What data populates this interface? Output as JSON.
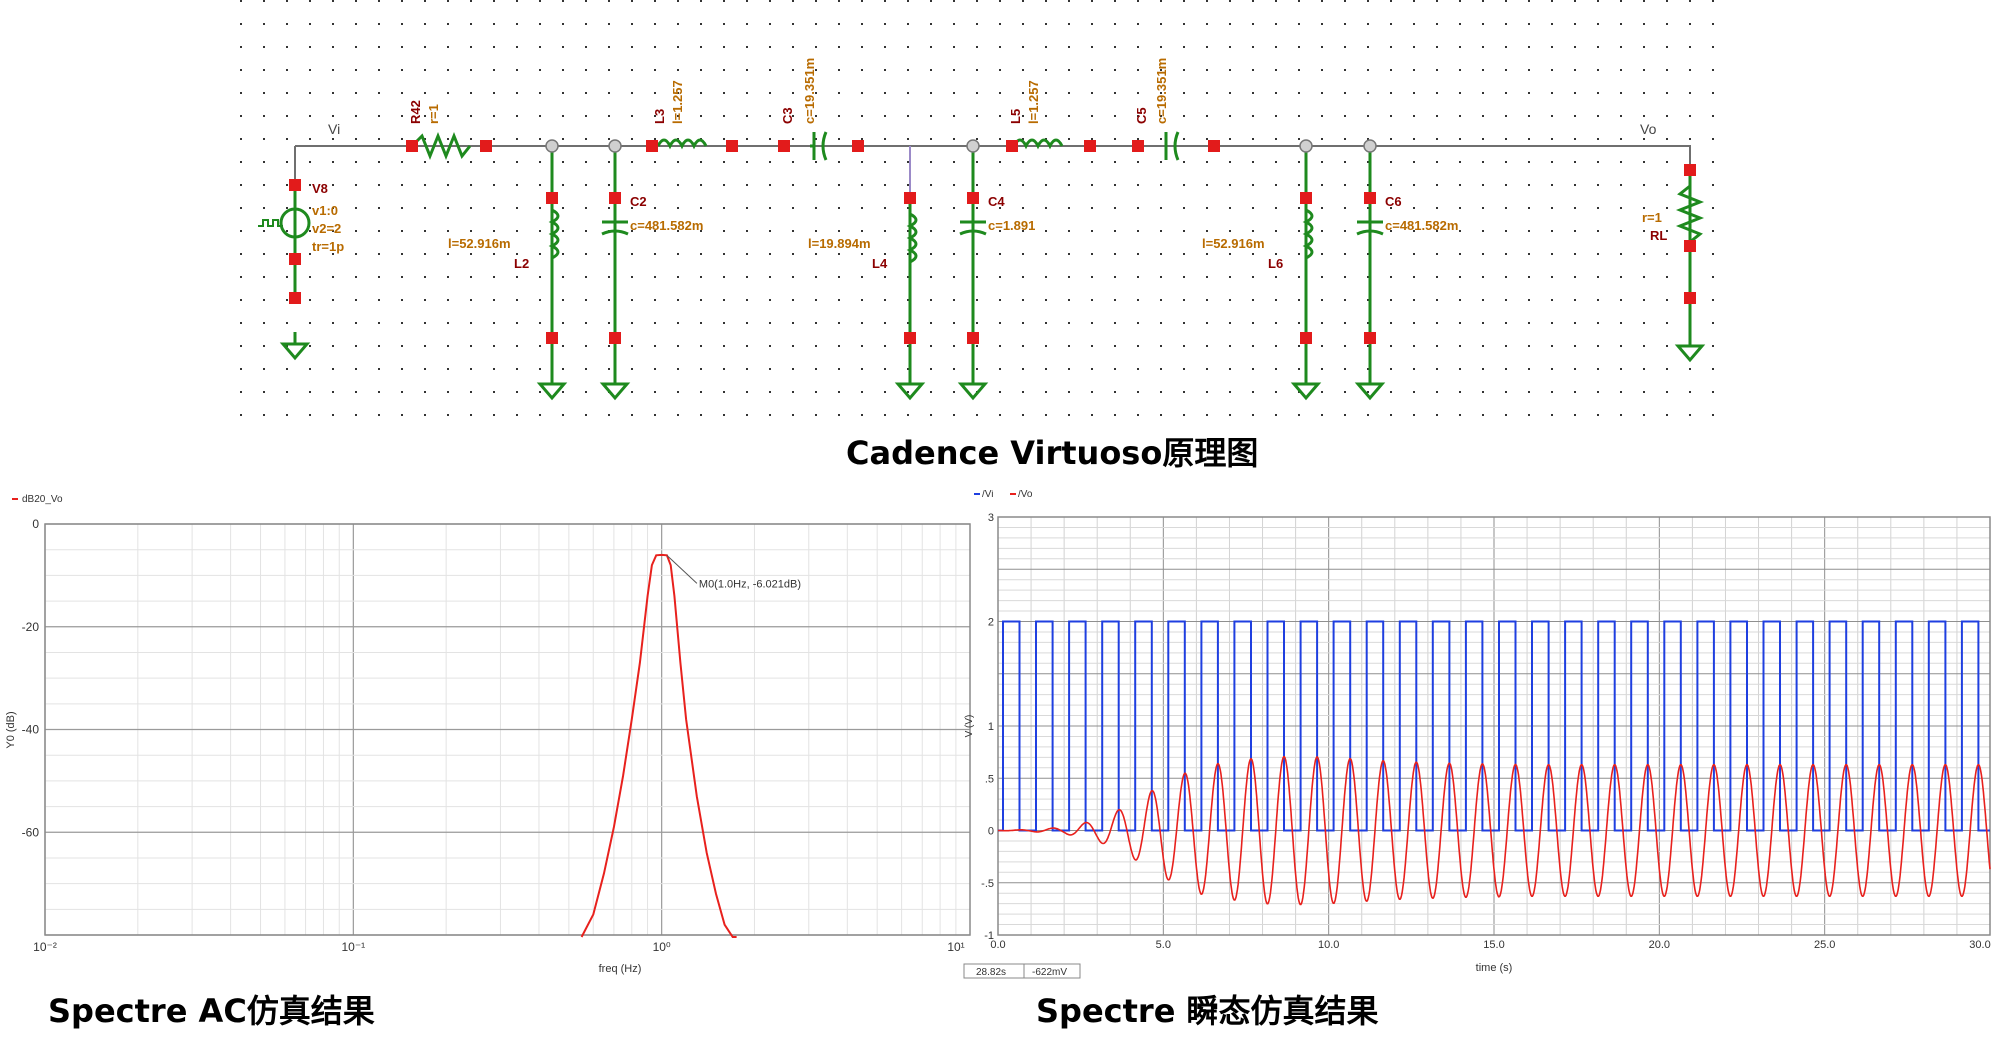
{
  "schematic": {
    "caption": "Cadence Virtuoso原理图",
    "net_labels": {
      "vi": "Vi",
      "vo": "Vo"
    },
    "source": {
      "name": "V8",
      "params": [
        "v1:0",
        "v2=2",
        "tr=1p"
      ]
    },
    "r_in": {
      "name": "R42",
      "value": "r=1"
    },
    "series_inductors": [
      {
        "name": "L3",
        "value": "l=1.257"
      },
      {
        "name": "L5",
        "value": "l=1.257"
      }
    ],
    "series_caps": [
      {
        "name": "C3",
        "value": "c=19.351m"
      },
      {
        "name": "C5",
        "value": "c=19.351m"
      }
    ],
    "shunt_inductors": [
      {
        "name": "L2",
        "value": "l=52.916m"
      },
      {
        "name": "L4",
        "value": "l=19.894m"
      },
      {
        "name": "L6",
        "value": "l=52.916m"
      }
    ],
    "shunt_caps": [
      {
        "name": "C2",
        "value": "c=481.582m"
      },
      {
        "name": "C4",
        "value": "c=1.891"
      },
      {
        "name": "C6",
        "value": "c=481.582m"
      }
    ],
    "load": {
      "name": "RL",
      "value": "r=1"
    }
  },
  "ac_plot": {
    "caption": "Spectre AC仿真结果",
    "legend": "dB20_Vo",
    "ylabel": "Y0 (dB)",
    "xlabel": "freq (Hz)",
    "y_ticks": [
      "0",
      "-20",
      "-40",
      "-60"
    ],
    "x_ticks": [
      "10⁻²",
      "10⁻¹",
      "10⁰",
      "10¹"
    ],
    "marker": "M0(1.0Hz, -6.021dB)",
    "colors": {
      "trace": "#e8211d",
      "grid": "#bfbfbf"
    }
  },
  "tran_plot": {
    "caption": "Spectre 瞬态仿真结果",
    "legend": [
      {
        "label": "/Vi",
        "color": "#1f3fe0"
      },
      {
        "label": "/Vo",
        "color": "#e8211d"
      }
    ],
    "ylabel": "V (V)",
    "xlabel": "time (s)",
    "y_ticks": [
      "3",
      "2",
      "1",
      ".5",
      "0",
      "-.5",
      "-1"
    ],
    "x_ticks": [
      "0.0",
      "5.0",
      "10.0",
      "15.0",
      "20.0",
      "25.0",
      "30.0"
    ],
    "readouts": [
      "28.82s",
      "-622mV"
    ]
  },
  "chart_data": [
    {
      "type": "line",
      "title": "",
      "xlabel": "freq (Hz)",
      "ylabel": "Y0 (dB)",
      "x_scale": "log",
      "xlim": [
        0.01,
        10
      ],
      "ylim": [
        -80,
        0
      ],
      "grid": true,
      "legend_position": "top-left",
      "series": [
        {
          "name": "dB20_Vo",
          "x": [
            0.55,
            0.6,
            0.65,
            0.7,
            0.75,
            0.8,
            0.85,
            0.9,
            0.93,
            0.96,
            1.0,
            1.04,
            1.07,
            1.1,
            1.15,
            1.2,
            1.3,
            1.4,
            1.5,
            1.6,
            1.7,
            1.75
          ],
          "y": [
            -84,
            -76,
            -68,
            -59,
            -49,
            -38,
            -27,
            -14,
            -8,
            -6.1,
            -6.02,
            -6.1,
            -8,
            -14,
            -27,
            -38,
            -53,
            -64,
            -72,
            -78,
            -84,
            -88
          ]
        }
      ],
      "annotations": [
        "M0(1.0Hz, -6.021dB)"
      ]
    },
    {
      "type": "line",
      "title": "",
      "xlabel": "time (s)",
      "ylabel": "V (V)",
      "xlim": [
        0,
        30
      ],
      "ylim": [
        -1,
        3
      ],
      "grid": true,
      "legend_position": "top-left",
      "series": [
        {
          "name": "/Vi",
          "waveform": "square",
          "period": 1.0,
          "low": 0,
          "high": 2
        },
        {
          "name": "/Vo",
          "waveform": "sine",
          "period": 1.0,
          "envelope_t": [
            0,
            1,
            2,
            3,
            4,
            5,
            6,
            7,
            8,
            9,
            10,
            11,
            12,
            14,
            16,
            20,
            25,
            30
          ],
          "envelope_amp": [
            0,
            0.01,
            0.03,
            0.1,
            0.25,
            0.45,
            0.6,
            0.66,
            0.7,
            0.71,
            0.7,
            0.68,
            0.66,
            0.64,
            0.63,
            0.63,
            0.63,
            0.63
          ]
        }
      ],
      "annotations": [
        "28.82s",
        "-622mV"
      ]
    }
  ]
}
